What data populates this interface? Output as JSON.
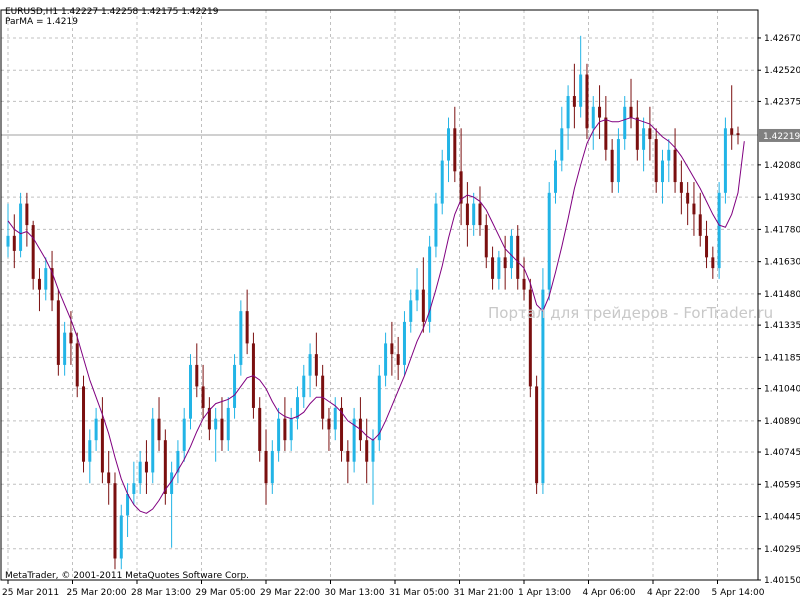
{
  "header": {
    "symbol_line": "EURUSD,H1  1.42227 1.42258 1.42175 1.42219",
    "indicator_line": "ParMA = 1.4219"
  },
  "watermark": "Портал для трейдеров - ForTrader.ru",
  "copyright": "MetaTrader, © 2001-2011 MetaQuotes Software Corp.",
  "colors": {
    "bull": "#22b4e6",
    "bear": "#7a0f0f",
    "ma": "#800080",
    "grid": "#c0c0c0",
    "current_price_line": "#a0a0a0",
    "price_box": "#808080"
  },
  "chart_data": {
    "type": "candlestick",
    "title": "",
    "symbol": "EURUSD",
    "timeframe": "H1",
    "indicator": {
      "name": "ParMA",
      "value": 1.4219
    },
    "current_price": 1.42219,
    "current_price_label": "1.42219",
    "ylim": [
      1.4015,
      1.428
    ],
    "y_ticks": [
      1.4267,
      1.4252,
      1.42375,
      1.4208,
      1.4193,
      1.4178,
      1.4163,
      1.4148,
      1.41335,
      1.41185,
      1.4104,
      1.4089,
      1.40745,
      1.40595,
      1.40445,
      1.40295,
      1.4015
    ],
    "y_tick_labels": [
      "1.42670",
      "1.42520",
      "1.42375",
      "1.42080",
      "1.41930",
      "1.41780",
      "1.41630",
      "1.41480",
      "1.41335",
      "1.41185",
      "1.41040",
      "1.40890",
      "1.40745",
      "1.40595",
      "1.40445",
      "1.40295",
      "1.40150"
    ],
    "x_tick_labels": [
      "25 Mar 2011",
      "25 Mar 20:00",
      "28 Mar 13:00",
      "29 Mar 05:00",
      "29 Mar 22:00",
      "30 Mar 13:00",
      "31 Mar 05:00",
      "31 Mar 21:00",
      "1 Apr 13:00",
      "4 Apr 06:00",
      "4 Apr 22:00",
      "5 Apr 14:00"
    ],
    "candles": [
      [
        1.417,
        1.419,
        1.4165,
        1.4175
      ],
      [
        1.4175,
        1.4185,
        1.416,
        1.4168
      ],
      [
        1.4168,
        1.4195,
        1.4165,
        1.419
      ],
      [
        1.419,
        1.4195,
        1.417,
        1.418
      ],
      [
        1.418,
        1.4182,
        1.415,
        1.4155
      ],
      [
        1.4155,
        1.416,
        1.414,
        1.415
      ],
      [
        1.415,
        1.4165,
        1.4145,
        1.416
      ],
      [
        1.416,
        1.4168,
        1.414,
        1.4145
      ],
      [
        1.4145,
        1.415,
        1.411,
        1.4115
      ],
      [
        1.4115,
        1.4135,
        1.411,
        1.413
      ],
      [
        1.413,
        1.414,
        1.4115,
        1.4125
      ],
      [
        1.4125,
        1.413,
        1.41,
        1.4105
      ],
      [
        1.4105,
        1.411,
        1.4065,
        1.407
      ],
      [
        1.407,
        1.4085,
        1.406,
        1.408
      ],
      [
        1.408,
        1.4095,
        1.4075,
        1.409
      ],
      [
        1.409,
        1.41,
        1.406,
        1.4065
      ],
      [
        1.4065,
        1.4075,
        1.405,
        1.406
      ],
      [
        1.406,
        1.4065,
        1.402,
        1.4025
      ],
      [
        1.4025,
        1.405,
        1.402,
        1.4045
      ],
      [
        1.4045,
        1.406,
        1.4035,
        1.4055
      ],
      [
        1.4055,
        1.407,
        1.405,
        1.406
      ],
      [
        1.406,
        1.4075,
        1.4055,
        1.407
      ],
      [
        1.407,
        1.408,
        1.4055,
        1.4065
      ],
      [
        1.4065,
        1.4095,
        1.406,
        1.409
      ],
      [
        1.409,
        1.41,
        1.4075,
        1.408
      ],
      [
        1.408,
        1.4085,
        1.405,
        1.4055
      ],
      [
        1.4055,
        1.407,
        1.403,
        1.4065
      ],
      [
        1.4065,
        1.408,
        1.406,
        1.4075
      ],
      [
        1.4075,
        1.4095,
        1.407,
        1.409
      ],
      [
        1.409,
        1.412,
        1.4085,
        1.4115
      ],
      [
        1.4115,
        1.4125,
        1.41,
        1.4105
      ],
      [
        1.4105,
        1.4115,
        1.409,
        1.4095
      ],
      [
        1.4095,
        1.41,
        1.408,
        1.4085
      ],
      [
        1.4085,
        1.4095,
        1.407,
        1.409
      ],
      [
        1.409,
        1.41,
        1.4075,
        1.408
      ],
      [
        1.408,
        1.41,
        1.4075,
        1.4095
      ],
      [
        1.4095,
        1.412,
        1.409,
        1.4115
      ],
      [
        1.4115,
        1.4145,
        1.411,
        1.414
      ],
      [
        1.414,
        1.415,
        1.412,
        1.4125
      ],
      [
        1.4125,
        1.413,
        1.409,
        1.4095
      ],
      [
        1.4095,
        1.41,
        1.407,
        1.4075
      ],
      [
        1.4075,
        1.4085,
        1.405,
        1.406
      ],
      [
        1.406,
        1.408,
        1.4055,
        1.4075
      ],
      [
        1.4075,
        1.4095,
        1.407,
        1.409
      ],
      [
        1.409,
        1.41,
        1.4075,
        1.408
      ],
      [
        1.408,
        1.4095,
        1.4075,
        1.409
      ],
      [
        1.409,
        1.4105,
        1.4085,
        1.41
      ],
      [
        1.41,
        1.4115,
        1.4095,
        1.411
      ],
      [
        1.411,
        1.4125,
        1.41,
        1.412
      ],
      [
        1.412,
        1.413,
        1.4105,
        1.411
      ],
      [
        1.411,
        1.4115,
        1.4085,
        1.409
      ],
      [
        1.409,
        1.4095,
        1.4075,
        1.4085
      ],
      [
        1.4085,
        1.41,
        1.408,
        1.4095
      ],
      [
        1.4095,
        1.41,
        1.407,
        1.4075
      ],
      [
        1.4075,
        1.408,
        1.406,
        1.407
      ],
      [
        1.407,
        1.4095,
        1.4065,
        1.409
      ],
      [
        1.409,
        1.41,
        1.4075,
        1.408
      ],
      [
        1.408,
        1.409,
        1.406,
        1.407
      ],
      [
        1.407,
        1.4085,
        1.405,
        1.408
      ],
      [
        1.408,
        1.4115,
        1.4075,
        1.411
      ],
      [
        1.411,
        1.413,
        1.4105,
        1.4125
      ],
      [
        1.4125,
        1.4135,
        1.411,
        1.412
      ],
      [
        1.412,
        1.4128,
        1.4108,
        1.4115
      ],
      [
        1.4115,
        1.414,
        1.411,
        1.4135
      ],
      [
        1.4135,
        1.415,
        1.413,
        1.4145
      ],
      [
        1.4145,
        1.416,
        1.414,
        1.415
      ],
      [
        1.415,
        1.4165,
        1.413,
        1.4135
      ],
      [
        1.4135,
        1.4175,
        1.413,
        1.417
      ],
      [
        1.417,
        1.4195,
        1.4165,
        1.419
      ],
      [
        1.419,
        1.4215,
        1.4185,
        1.421
      ],
      [
        1.421,
        1.423,
        1.42,
        1.4225
      ],
      [
        1.4225,
        1.4235,
        1.42,
        1.4205
      ],
      [
        1.4205,
        1.4225,
        1.418,
        1.419
      ],
      [
        1.419,
        1.42,
        1.417,
        1.418
      ],
      [
        1.418,
        1.4195,
        1.4175,
        1.419
      ],
      [
        1.419,
        1.4198,
        1.4175,
        1.418
      ],
      [
        1.418,
        1.4185,
        1.416,
        1.4165
      ],
      [
        1.4165,
        1.417,
        1.415,
        1.4155
      ],
      [
        1.4155,
        1.4168,
        1.415,
        1.4165
      ],
      [
        1.4165,
        1.4175,
        1.415,
        1.416
      ],
      [
        1.416,
        1.4178,
        1.4155,
        1.4175
      ],
      [
        1.4175,
        1.418,
        1.415,
        1.4155
      ],
      [
        1.4155,
        1.4165,
        1.4145,
        1.415
      ],
      [
        1.415,
        1.4155,
        1.41,
        1.4105
      ],
      [
        1.4105,
        1.411,
        1.4055,
        1.406
      ],
      [
        1.406,
        1.416,
        1.4055,
        1.415
      ],
      [
        1.415,
        1.42,
        1.4145,
        1.4195
      ],
      [
        1.4195,
        1.4215,
        1.419,
        1.421
      ],
      [
        1.421,
        1.4235,
        1.4205,
        1.4225
      ],
      [
        1.4225,
        1.4245,
        1.4215,
        1.424
      ],
      [
        1.424,
        1.4255,
        1.4225,
        1.4235
      ],
      [
        1.4235,
        1.4268,
        1.423,
        1.425
      ],
      [
        1.425,
        1.4255,
        1.422,
        1.4225
      ],
      [
        1.4225,
        1.424,
        1.4215,
        1.4235
      ],
      [
        1.4235,
        1.4245,
        1.422,
        1.423
      ],
      [
        1.423,
        1.424,
        1.421,
        1.4215
      ],
      [
        1.4215,
        1.422,
        1.4195,
        1.42
      ],
      [
        1.42,
        1.4225,
        1.4195,
        1.422
      ],
      [
        1.422,
        1.424,
        1.4215,
        1.4235
      ],
      [
        1.4235,
        1.4248,
        1.4225,
        1.423
      ],
      [
        1.423,
        1.4238,
        1.421,
        1.4215
      ],
      [
        1.4215,
        1.423,
        1.4205,
        1.4225
      ],
      [
        1.4225,
        1.4235,
        1.421,
        1.422
      ],
      [
        1.422,
        1.4225,
        1.4195,
        1.42
      ],
      [
        1.42,
        1.4215,
        1.419,
        1.421
      ],
      [
        1.421,
        1.422,
        1.42,
        1.4215
      ],
      [
        1.4215,
        1.4225,
        1.4195,
        1.42
      ],
      [
        1.42,
        1.421,
        1.4185,
        1.4195
      ],
      [
        1.4195,
        1.42,
        1.418,
        1.419
      ],
      [
        1.419,
        1.42,
        1.4175,
        1.4185
      ],
      [
        1.4185,
        1.4195,
        1.417,
        1.4175
      ],
      [
        1.4175,
        1.4182,
        1.416,
        1.4165
      ],
      [
        1.4165,
        1.417,
        1.4155,
        1.416
      ],
      [
        1.416,
        1.42,
        1.4155,
        1.4195
      ],
      [
        1.4195,
        1.423,
        1.419,
        1.4225
      ],
      [
        1.4225,
        1.4245,
        1.4215,
        1.4222
      ],
      [
        1.42227,
        1.42258,
        1.42175,
        1.42219
      ]
    ],
    "ma_values": [
      1.4182,
      1.4178,
      1.4176,
      1.4177,
      1.4174,
      1.4169,
      1.4164,
      1.4158,
      1.415,
      1.4143,
      1.4136,
      1.4128,
      1.4118,
      1.4108,
      1.41,
      1.4092,
      1.4083,
      1.4072,
      1.4062,
      1.4055,
      1.405,
      1.4047,
      1.4046,
      1.4048,
      1.4052,
      1.4057,
      1.4061,
      1.4066,
      1.4071,
      1.4077,
      1.4084,
      1.409,
      1.4094,
      1.4097,
      1.4098,
      1.4099,
      1.4101,
      1.4105,
      1.4109,
      1.411,
      1.4108,
      1.4104,
      1.4098,
      1.4093,
      1.4091,
      1.409,
      1.4091,
      1.4093,
      1.4097,
      1.41,
      1.41,
      1.4098,
      1.4096,
      1.4093,
      1.4089,
      1.4087,
      1.4085,
      1.4082,
      1.408,
      1.4083,
      1.4089,
      1.4096,
      1.4103,
      1.411,
      1.4118,
      1.4126,
      1.4132,
      1.414,
      1.415,
      1.4161,
      1.4174,
      1.4185,
      1.4192,
      1.4194,
      1.4193,
      1.4191,
      1.4187,
      1.4181,
      1.4175,
      1.4169,
      1.4166,
      1.4163,
      1.416,
      1.4153,
      1.4143,
      1.414,
      1.4147,
      1.4158,
      1.417,
      1.4183,
      1.4197,
      1.4208,
      1.4218,
      1.4224,
      1.4228,
      1.4229,
      1.4228,
      1.4228,
      1.4229,
      1.423,
      1.4229,
      1.4228,
      1.4227,
      1.4224,
      1.4221,
      1.4219,
      1.4216,
      1.4212,
      1.4207,
      1.4202,
      1.4197,
      1.4191,
      1.4185,
      1.418,
      1.4179,
      1.4185,
      1.4195,
      1.4219
    ]
  }
}
